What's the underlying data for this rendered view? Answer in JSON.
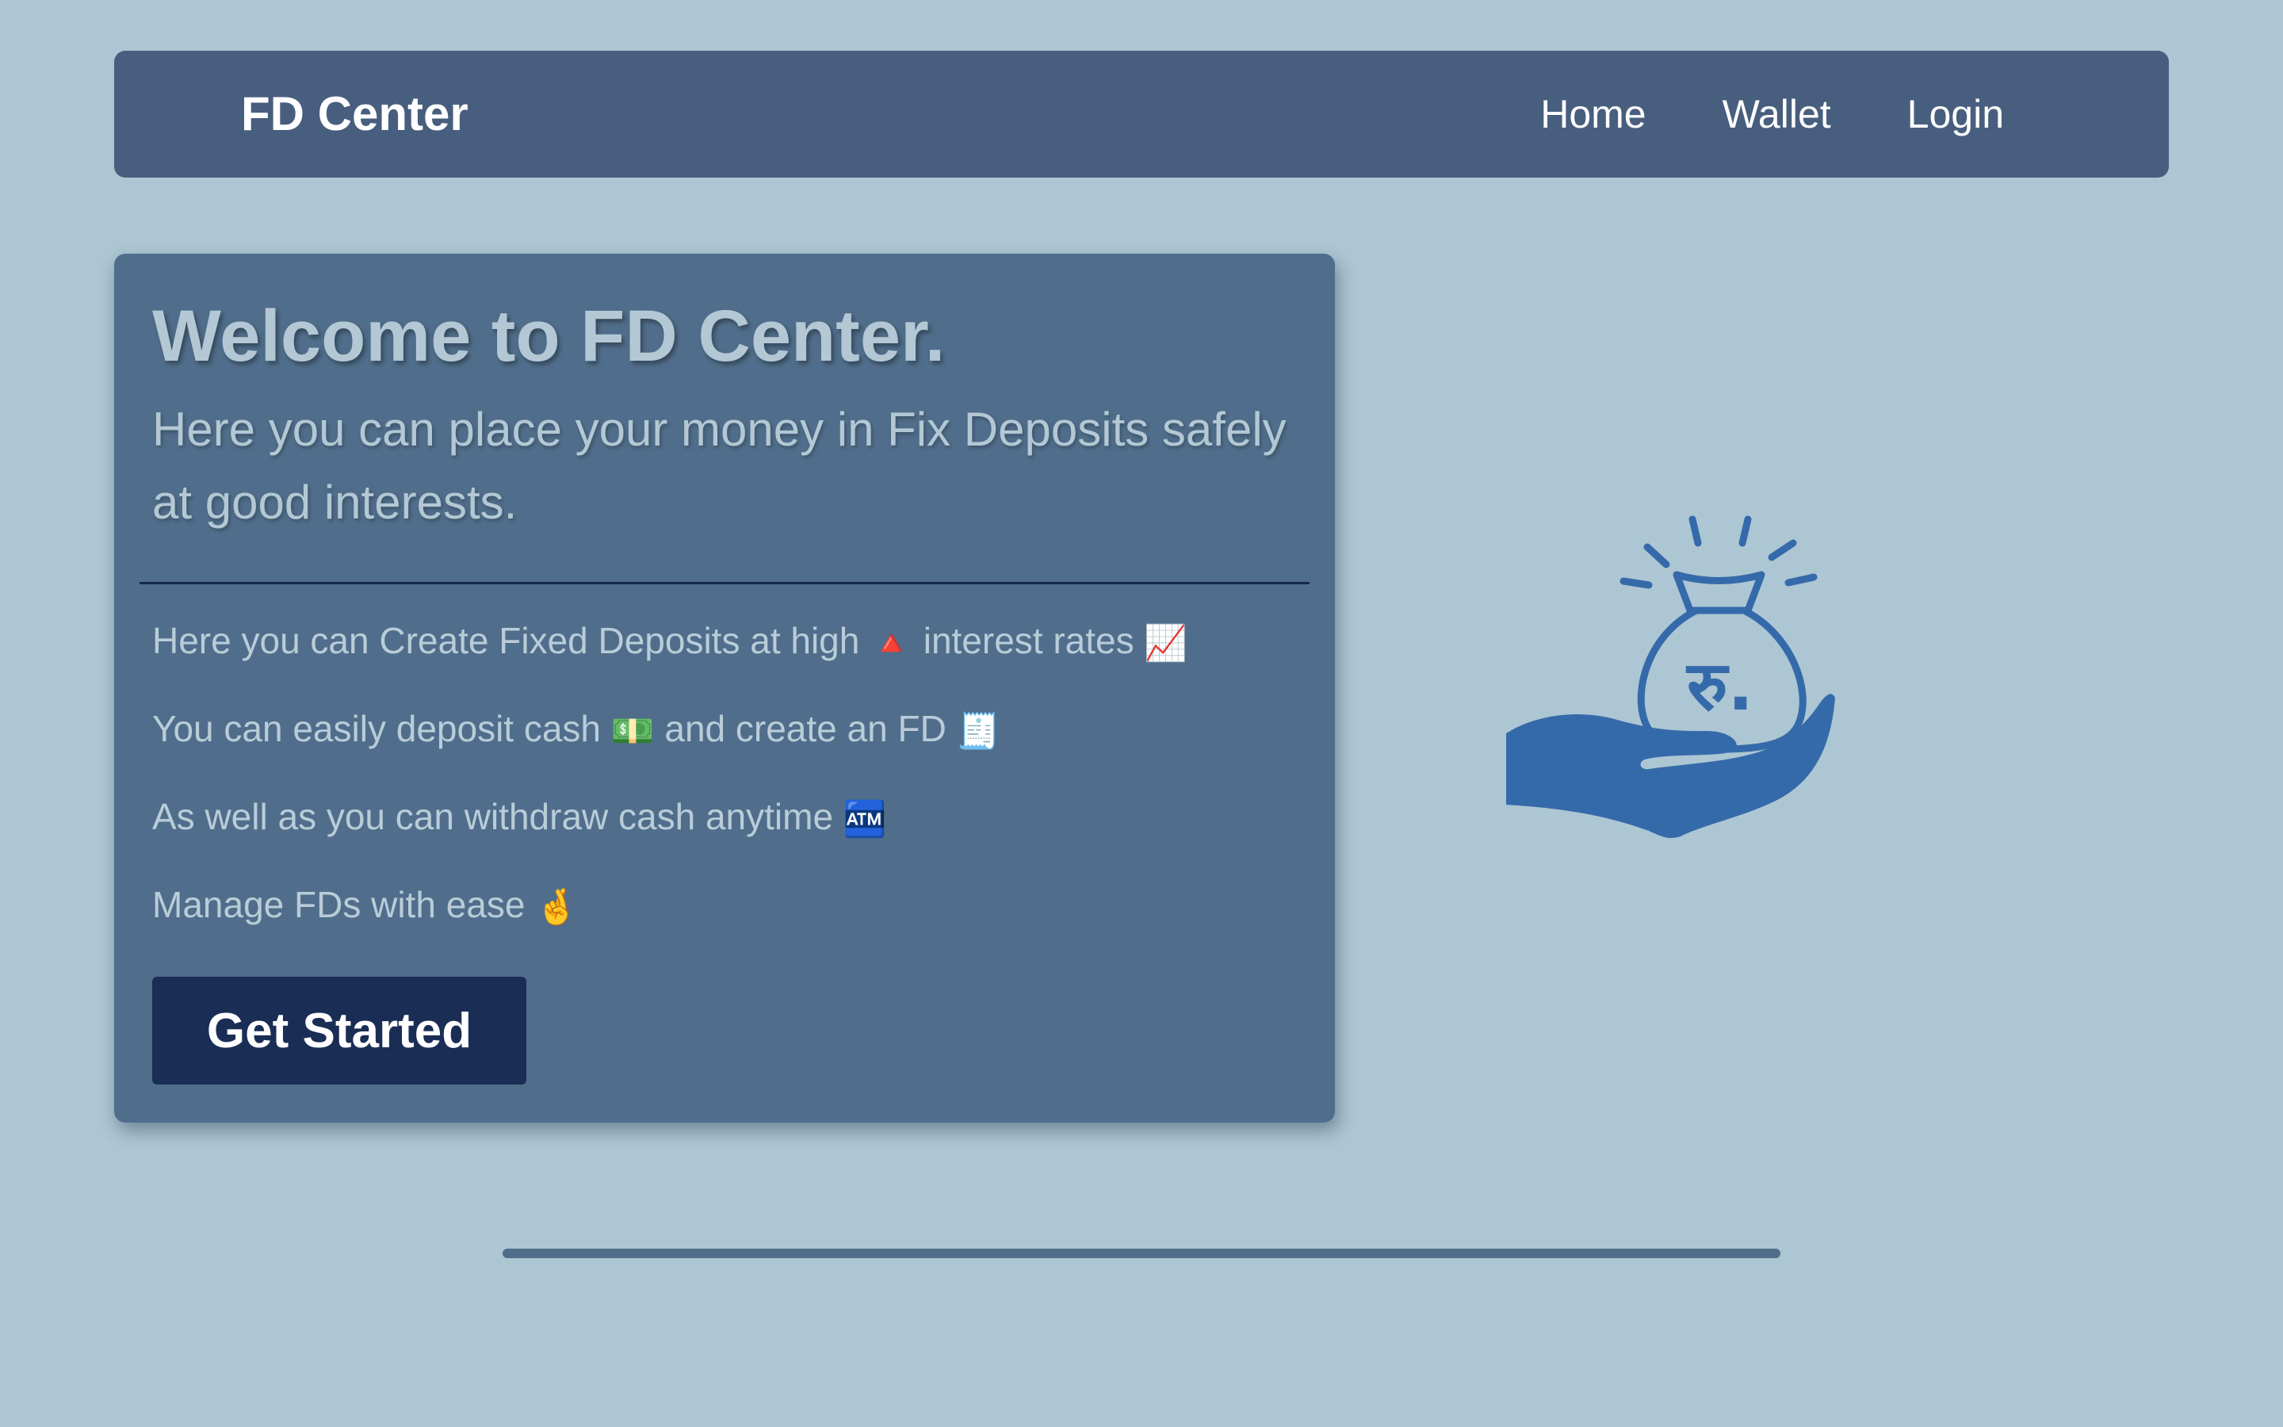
{
  "navbar": {
    "brand": "FD Center",
    "links": [
      {
        "label": "Home"
      },
      {
        "label": "Wallet"
      },
      {
        "label": "Login"
      }
    ]
  },
  "hero": {
    "title": "Welcome to FD Center.",
    "subtitle": "Here you can place your money in Fix Deposits safely at good interests.",
    "features": [
      {
        "before": "Here you can Create Fixed Deposits at high",
        "emoji1": "🔺",
        "middle": "interest rates",
        "emoji2": "📈"
      },
      {
        "before": "You can easily deposit cash",
        "emoji1": "💵",
        "middle": "and create an FD",
        "emoji2": "🧾"
      },
      {
        "before": "As well as you can withdraw cash anytime",
        "emoji1": "🏧"
      },
      {
        "before": "Manage FDs with ease",
        "emoji1": "🤞"
      }
    ],
    "cta_label": "Get Started"
  },
  "illustration": {
    "icon": "hand-holding-rupee-money-bag-icon",
    "symbol": "रु.",
    "color": "#356aaa"
  },
  "colors": {
    "background": "#adc6d3",
    "navbar": "#485e7e",
    "card": "#506e8b",
    "button": "#1a2d55"
  }
}
